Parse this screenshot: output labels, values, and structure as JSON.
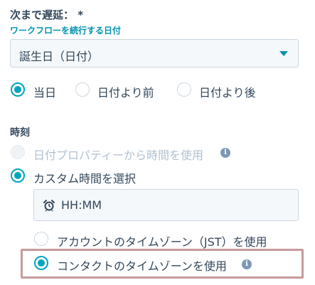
{
  "header": {
    "title": "次まで遅延： *",
    "subtitle": "ワークフローを続行する日付"
  },
  "date_select": {
    "value": "誕生日（日付）"
  },
  "day_options": [
    {
      "label": "当日",
      "selected": true
    },
    {
      "label": "日付より前",
      "selected": false
    },
    {
      "label": "日付より後",
      "selected": false
    }
  ],
  "time": {
    "section_label": "時刻",
    "options": [
      {
        "label": "日付プロパティーから時間を使用",
        "selected": false,
        "disabled": true
      },
      {
        "label": "カスタム時間を選択",
        "selected": true,
        "disabled": false
      }
    ],
    "time_input_placeholder": "HH:MM"
  },
  "timezone_options": [
    {
      "label": "アカウントのタイムゾーン（JST）を使用",
      "selected": false
    },
    {
      "label": "コンタクトのタイムゾーンを使用",
      "selected": true
    }
  ],
  "icons": {
    "alarm": "alarm-clock-icon",
    "info": "info-icon",
    "caret": "chevron-down-icon"
  },
  "colors": {
    "accent": "#00a4bd",
    "link": "#0091ae",
    "text": "#33475b",
    "highlight_border": "#c79a9d"
  },
  "info_glyph": "i"
}
